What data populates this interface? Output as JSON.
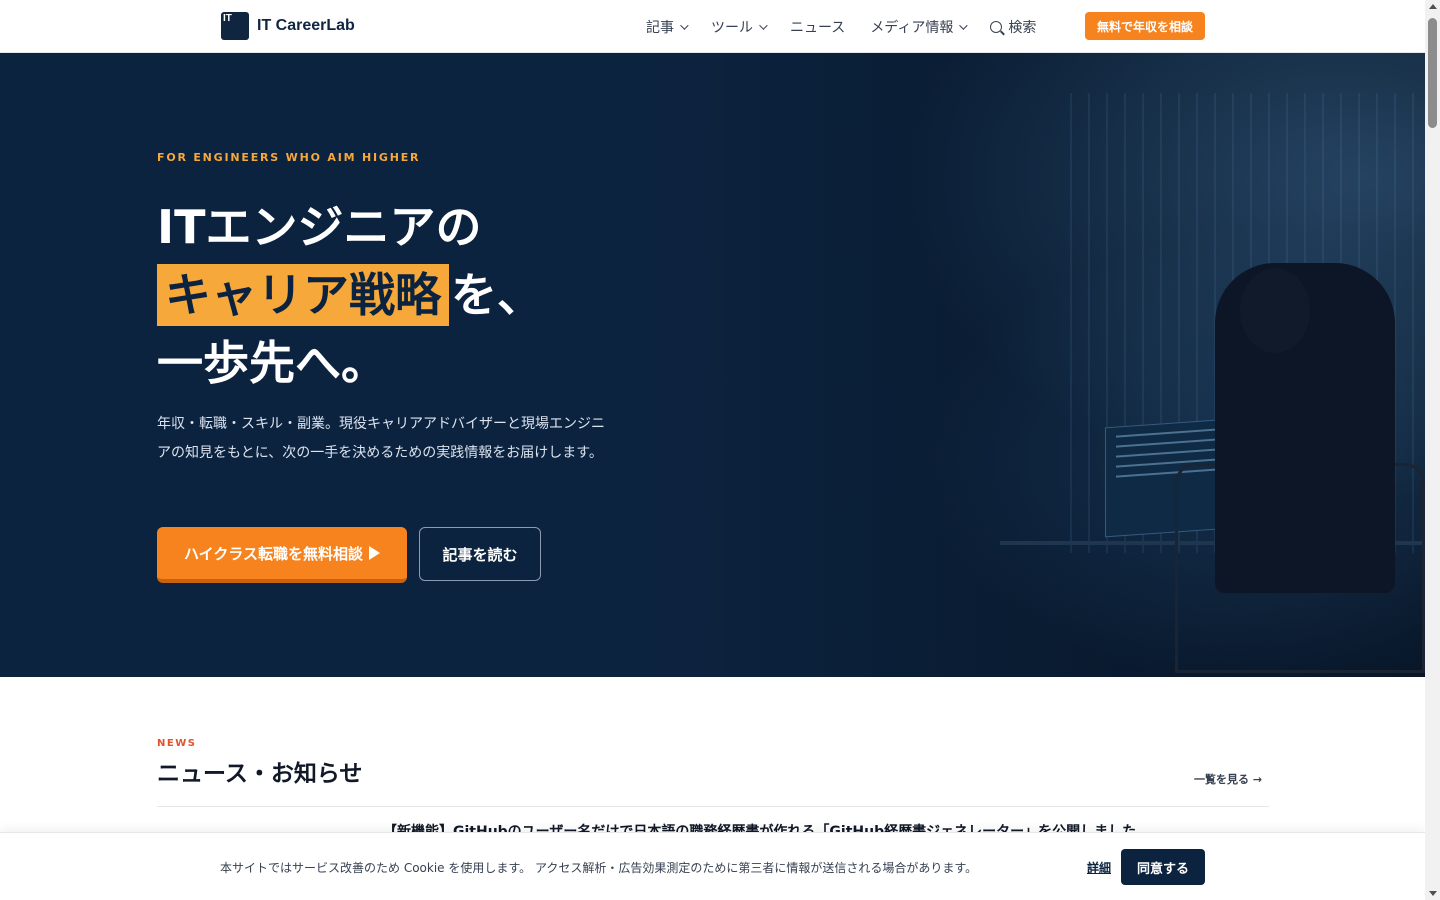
{
  "header": {
    "logo_mark": "IT",
    "logo_text": "IT CareerLab",
    "nav": {
      "articles": "記事",
      "tools": "ツール",
      "news": "ニュース",
      "media": "メディア情報",
      "search": "検索"
    },
    "cta": "無料で年収を相談"
  },
  "hero": {
    "eyebrow": "FOR ENGINEERS WHO AIM HIGHER",
    "title_line1": "ITエンジニアの",
    "title_highlight": "キャリア戦略",
    "title_line2_rest": "を、",
    "title_line3": "一歩先へ。",
    "description": "年収・転職・スキル・副業。現役キャリアアドバイザーと現場エンジニアの知見をもとに、次の一手を決めるための実践情報をお届けします。",
    "primary_button": "ハイクラス転職を無料相談",
    "secondary_button": "記事を読む"
  },
  "news": {
    "eyebrow": "NEWS",
    "title": "ニュース・お知らせ",
    "more_link": "一覧を見る →",
    "headline": "【新機能】GitHubのユーザー名だけで日本語の職務経歴書が作れる「GitHub経歴書ジェネレーター」を公開しました"
  },
  "cookie": {
    "text": "本サイトではサービス改善のため Cookie を使用します。 アクセス解析・広告効果測定のために第三者に情報が送信される場合があります。",
    "detail_link": "詳細",
    "accept_button": "同意する"
  },
  "colors": {
    "navy": "#0c2340",
    "orange": "#f7831f",
    "amber": "#f6a83a",
    "news_red": "#e0532d"
  }
}
